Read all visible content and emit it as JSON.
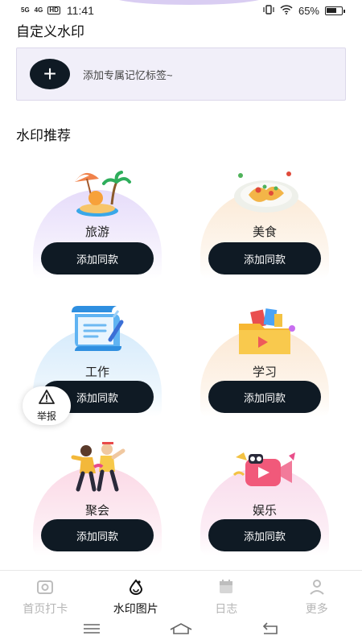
{
  "status_bar": {
    "signal_1": "5G",
    "signal_2": "4G",
    "hd": "HD",
    "time": "11:41",
    "battery": "65%"
  },
  "custom": {
    "title": "自定义水印",
    "hint": "添加专属记忆标签~",
    "add_symbol": "+"
  },
  "recommend": {
    "title": "水印推荐",
    "cards": [
      {
        "label": "旅游",
        "button": "添加同款",
        "icon": "travel-beach-icon",
        "bg": "#ece4fb"
      },
      {
        "label": "美食",
        "button": "添加同款",
        "icon": "food-plate-icon",
        "bg": "#fdf1e4"
      },
      {
        "label": "工作",
        "button": "添加同款",
        "icon": "work-scroll-icon",
        "bg": "#e1f0fb"
      },
      {
        "label": "学习",
        "button": "添加同款",
        "icon": "study-folder-icon",
        "bg": "#fdf0e2"
      },
      {
        "label": "聚会",
        "button": "添加同款",
        "icon": "party-people-icon",
        "bg": "#fce6ef"
      },
      {
        "label": "娱乐",
        "button": "添加同款",
        "icon": "entertainment-video-icon",
        "bg": "#fbe7f1"
      }
    ]
  },
  "report": {
    "label": "举报",
    "icon": "warning-icon"
  },
  "tabbar": {
    "tabs": [
      {
        "label": "首页打卡",
        "icon": "camera-icon",
        "active": false
      },
      {
        "label": "水印图片",
        "icon": "drop-icon",
        "active": true
      },
      {
        "label": "日志",
        "icon": "calendar-icon",
        "active": false
      },
      {
        "label": "更多",
        "icon": "person-icon",
        "active": false
      }
    ]
  },
  "colors": {
    "button_dark": "#0f1a24",
    "card_bg_custom": "#f1eff9",
    "tab_inactive": "#b5b5b5"
  }
}
